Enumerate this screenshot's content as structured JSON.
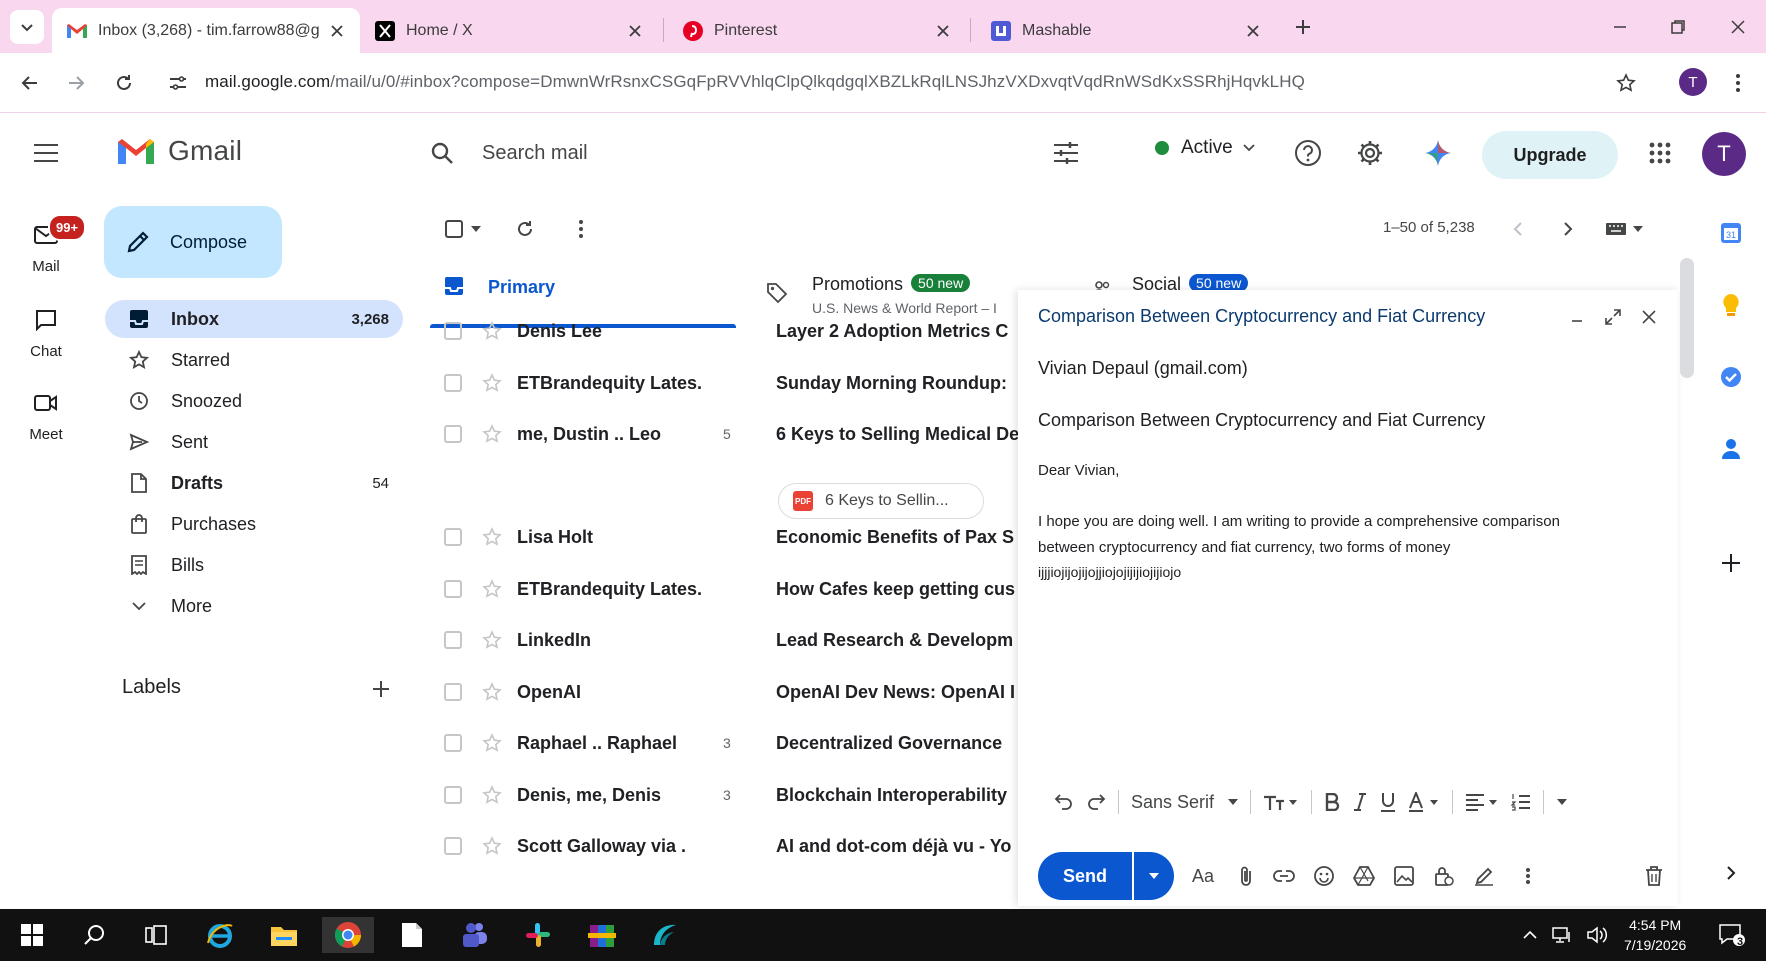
{
  "browser": {
    "tabs": [
      {
        "title": "Inbox (3,268) - tim.farrow88@g",
        "icon": "gmail-icon",
        "active": true
      },
      {
        "title": "Home / X",
        "icon": "x-icon",
        "active": false
      },
      {
        "title": "Pinterest",
        "icon": "pinterest-icon",
        "active": false
      },
      {
        "title": "Mashable",
        "icon": "mashable-icon",
        "active": false
      }
    ],
    "url_host": "mail.google.com",
    "url_path": "/mail/u/0/#inbox?compose=DmwnWrRsnxCSGqFpRVVhlqClpQlkqdgqlXBZLkRqlLNSJhzVXDxvqtVqdRnWSdKxSSRhjHqvkLHQ",
    "profile_letter": "T"
  },
  "gmail": {
    "logo_text": "Gmail",
    "search_placeholder": "Search mail",
    "status": "Active",
    "upgrade_label": "Upgrade",
    "avatar_letter": "T",
    "rail": {
      "mail_label": "Mail",
      "mail_badge": "99+",
      "chat_label": "Chat",
      "meet_label": "Meet"
    },
    "compose_label": "Compose",
    "folders": [
      {
        "label": "Inbox",
        "count": "3,268"
      },
      {
        "label": "Starred",
        "count": ""
      },
      {
        "label": "Snoozed",
        "count": ""
      },
      {
        "label": "Sent",
        "count": ""
      },
      {
        "label": "Drafts",
        "count": "54"
      },
      {
        "label": "Purchases",
        "count": ""
      },
      {
        "label": "Bills",
        "count": ""
      },
      {
        "label": "More",
        "count": ""
      }
    ],
    "labels_title": "Labels",
    "pager": "1–50 of 5,238",
    "category_tabs": {
      "primary": "Primary",
      "promotions": "Promotions",
      "promotions_badge": "50 new",
      "promotions_sub": "U.S. News & World Report – I",
      "social": "Social",
      "social_badge": "50 new"
    },
    "emails": [
      {
        "sender": "Denis Lee",
        "count": "",
        "subject": "Layer 2 Adoption Metrics C"
      },
      {
        "sender": "ETBrandequity Lates.",
        "count": "",
        "subject": "Sunday Morning Roundup:"
      },
      {
        "sender": "me, Dustin .. Leo",
        "count": "5",
        "subject": "6 Keys to Selling Medical De"
      },
      {
        "sender": "Lisa Holt",
        "count": "",
        "subject": "Economic Benefits of Pax S"
      },
      {
        "sender": "ETBrandequity Lates.",
        "count": "",
        "subject": "How Cafes keep getting cus"
      },
      {
        "sender": "LinkedIn",
        "count": "",
        "subject": "Lead Research & Developm"
      },
      {
        "sender": "OpenAI",
        "count": "",
        "subject": "OpenAI Dev News: OpenAI I"
      },
      {
        "sender": "Raphael .. Raphael",
        "count": "3",
        "subject": "Decentralized Governance"
      },
      {
        "sender": "Denis, me, Denis",
        "count": "3",
        "subject": "Blockchain Interoperability"
      },
      {
        "sender": "Scott Galloway via .",
        "count": "",
        "subject": "AI and dot-com déjà vu - Yo"
      }
    ],
    "attachment_chip": "6 Keys to Sellin...",
    "compose_window": {
      "title": "Comparison Between Cryptocurrency and Fiat Currency",
      "to": "Vivian Depaul (gmail.com)",
      "subject": "Comparison Between Cryptocurrency and Fiat Currency",
      "greeting": "Dear Vivian,",
      "body_line1": "I hope you are doing well. I am writing to provide a comprehensive comparison",
      "body_line2": "between cryptocurrency and fiat currency, two forms of money",
      "body_line3": "ijjjiojijojijojjiojojijijiojijiojo",
      "font_name": "Sans Serif",
      "send_label": "Send"
    }
  },
  "taskbar": {
    "time": "4:54 PM",
    "date": "7/19/2026",
    "notification_count": "3"
  },
  "colors": {
    "tab_strip": "#f8d7ef",
    "accent_blue": "#0b57d0",
    "compose_button": "#c2e7ff",
    "selected_folder": "#d3e3fd",
    "new_badge_green": "#188038"
  }
}
